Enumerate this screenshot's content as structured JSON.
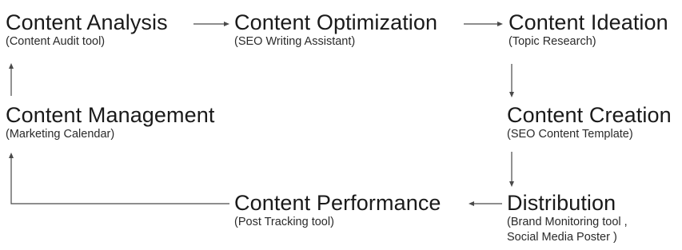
{
  "nodes": {
    "analysis": {
      "title": "Content Analysis",
      "subtitle": "(Content Audit tool)"
    },
    "optimization": {
      "title": "Content Optimization",
      "subtitle": "(SEO Writing Assistant)"
    },
    "ideation": {
      "title": "Content Ideation",
      "subtitle": "(Topic Research)"
    },
    "management": {
      "title": "Content Management",
      "subtitle": "(Marketing Calendar)"
    },
    "creation": {
      "title": "Content Creation",
      "subtitle": "(SEO Content Template)"
    },
    "performance": {
      "title": "Content Performance",
      "subtitle": "(Post Tracking tool)"
    },
    "distribution": {
      "title": "Distribution",
      "subtitle_line1": "(Brand Monitoring tool ,",
      "subtitle_line2": "Social Media Poster )"
    }
  },
  "flow": [
    "Content Analysis",
    "Content Optimization",
    "Content Ideation",
    "Content Creation",
    "Distribution",
    "Content Performance",
    "Content Management",
    "Content Analysis"
  ],
  "colors": {
    "text": "#1a1a1a",
    "arrow": "#4a4a4a",
    "background": "#ffffff"
  }
}
